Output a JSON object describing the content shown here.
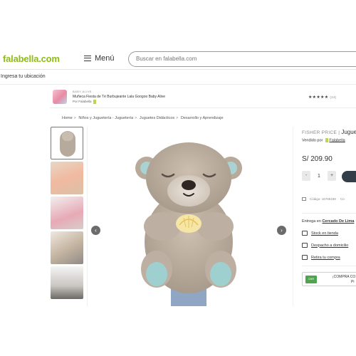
{
  "header": {
    "logo": "falabella.com",
    "menu_label": "Menú",
    "search_placeholder": "Buscar en falabella.com"
  },
  "location_label": "Ingresa tu ubicación",
  "promo": {
    "brand": "BABY ALIVE",
    "title": "Muñeca Fiesta de Té Burbujeante Lala Googoo Baby Alive",
    "seller": "Por Falabella",
    "stars": "★★★★★",
    "rating_count": "(24)"
  },
  "breadcrumb": [
    "Home",
    "Niños y Juguetería - Juguetería",
    "Juguetes Didácticos",
    "Desarrollo y Aprendizaje"
  ],
  "breadcrumb_sep": ">",
  "gallery": {
    "prev_icon": "‹",
    "next_icon": "›"
  },
  "product": {
    "brand": "FISHER PRICE",
    "brand_sep": "|",
    "name": "Juguete",
    "sold_by_label": "Vendido por",
    "seller": "Falabella",
    "price": "S/ 209.90",
    "qty_minus": "-",
    "quantity": "1",
    "qty_plus": "+",
    "code": "Código: 16765169",
    "code_suffix": "Co"
  },
  "delivery": {
    "label": "Entrega en",
    "location": "Cercado De Lima",
    "options": [
      "Stock en tienda",
      "Despacho a domicilio",
      "Retira tu compra"
    ]
  },
  "promo_box": {
    "badge": "CMR",
    "line1": "¡COMPRA CO",
    "line2": "Pi"
  },
  "colors": {
    "brand_green": "#8fbc1a",
    "button_dark": "#343e48",
    "cmr_green": "#4da64d"
  }
}
